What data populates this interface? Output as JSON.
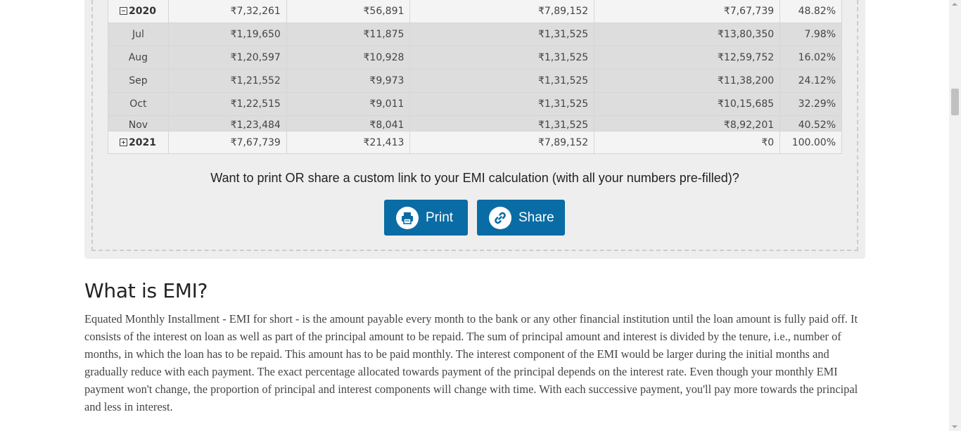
{
  "table": {
    "year_2020": {
      "year": "2020",
      "principal": "₹7,32,261",
      "interest": "₹56,891",
      "total": "₹7,89,152",
      "balance": "₹7,67,739",
      "paid": "48.82%"
    },
    "months": [
      {
        "month": "Jul",
        "principal": "₹1,19,650",
        "interest": "₹11,875",
        "total": "₹1,31,525",
        "balance": "₹13,80,350",
        "paid": "7.98%"
      },
      {
        "month": "Aug",
        "principal": "₹1,20,597",
        "interest": "₹10,928",
        "total": "₹1,31,525",
        "balance": "₹12,59,752",
        "paid": "16.02%"
      },
      {
        "month": "Sep",
        "principal": "₹1,21,552",
        "interest": "₹9,973",
        "total": "₹1,31,525",
        "balance": "₹11,38,200",
        "paid": "24.12%"
      },
      {
        "month": "Oct",
        "principal": "₹1,22,515",
        "interest": "₹9,011",
        "total": "₹1,31,525",
        "balance": "₹10,15,685",
        "paid": "32.29%"
      },
      {
        "month": "Nov",
        "principal": "₹1,23,484",
        "interest": "₹8,041",
        "total": "₹1,31,525",
        "balance": "₹8,92,201",
        "paid": "40.52%"
      }
    ],
    "year_2021": {
      "year": "2021",
      "principal": "₹7,67,739",
      "interest": "₹21,413",
      "total": "₹7,89,152",
      "balance": "₹0",
      "paid": "100.00%"
    }
  },
  "share": {
    "question": "Want to print OR share a custom link to your EMI calculation (with all your numbers pre-filled)?",
    "print_label": "Print",
    "share_label": "Share",
    "button_color": "#0a6ca4",
    "print_icon": "printer-icon",
    "share_icon": "link-icon"
  },
  "article": {
    "title": "What is EMI?",
    "body": "Equated Monthly Installment - EMI for short - is the amount payable every month to the bank or any other financial institution until the loan amount is fully paid off. It consists of the interest on loan as well as part of the principal amount to be repaid. The sum of principal amount and interest is divided by the tenure, i.e., number of months, in which the loan has to be repaid. This amount has to be paid monthly. The interest component of the EMI would be larger during the initial months and gradually reduce with each payment. The exact percentage allocated towards payment of the principal depends on the interest rate. Even though your monthly EMI payment won't change, the proportion of principal and interest components will change with time. With each successive payment, you'll pay more towards the principal and less in interest."
  }
}
